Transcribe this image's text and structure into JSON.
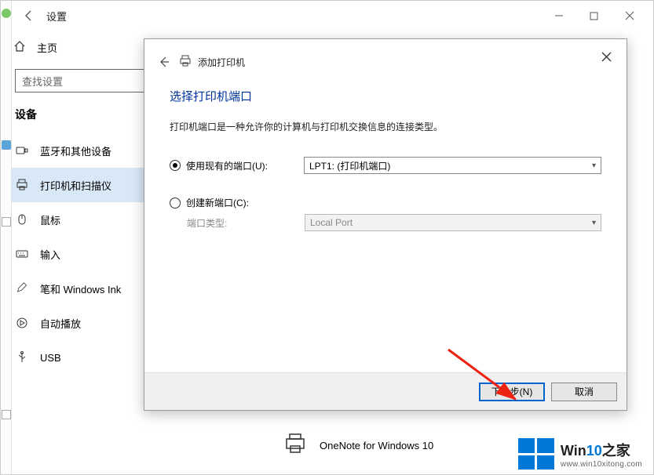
{
  "titlebar": {
    "title": "设置"
  },
  "sidebar": {
    "home": "主页",
    "search_placeholder": "查找设置",
    "category": "设备",
    "items": [
      {
        "label": "蓝牙和其他设备"
      },
      {
        "label": "打印机和扫描仪"
      },
      {
        "label": "鼠标"
      },
      {
        "label": "输入"
      },
      {
        "label": "笔和 Windows Ink"
      },
      {
        "label": "自动播放"
      },
      {
        "label": "USB"
      }
    ]
  },
  "main": {
    "printer_item": "OneNote for Windows 10"
  },
  "dialog": {
    "breadcrumb": "添加打印机",
    "title": "选择打印机端口",
    "description": "打印机端口是一种允许你的计算机与打印机交换信息的连接类型。",
    "opt_existing": "使用现有的端口(U):",
    "opt_existing_value": "LPT1: (打印机端口)",
    "opt_create": "创建新端口(C):",
    "port_type_label": "端口类型:",
    "port_type_value": "Local Port",
    "btn_next": "下一步(N)",
    "btn_cancel": "取消"
  },
  "watermark": {
    "line1_a": "Win",
    "line1_b": "10",
    "line1_c": "之家",
    "line2": "www.win10xitong.com"
  }
}
